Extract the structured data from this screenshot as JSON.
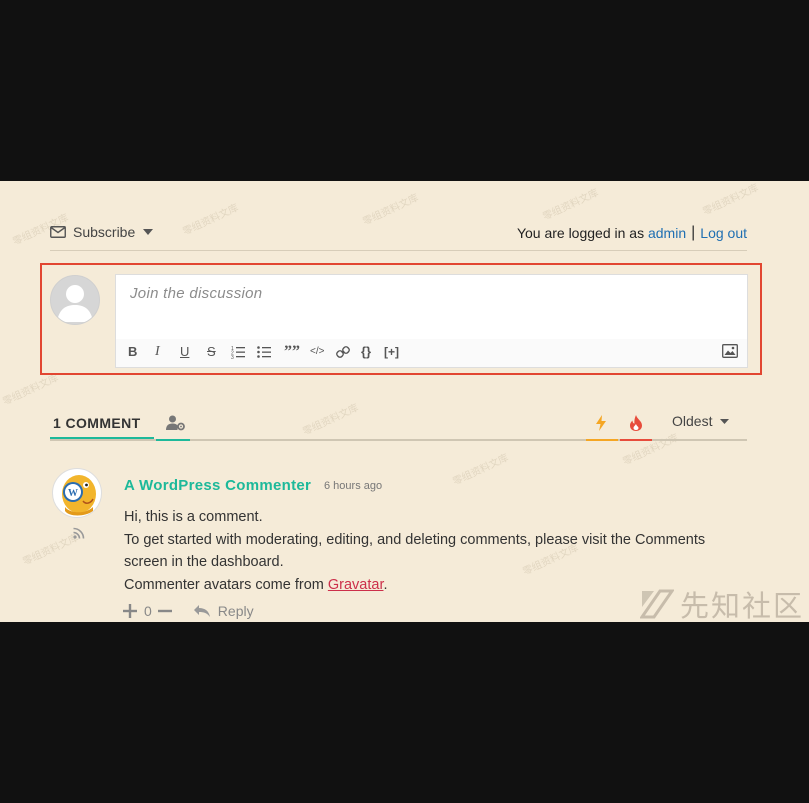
{
  "header": {
    "subscribe_label": "Subscribe",
    "logged_in_text": "You are logged in as",
    "username": "admin",
    "separator": "|",
    "logout_label": "Log out"
  },
  "editor": {
    "placeholder": "Join the discussion",
    "toolbar": {
      "bold": "B",
      "italic": "I",
      "underline": "U",
      "strike": "S",
      "quote": "”",
      "code": "</>",
      "sourcecode": "{}",
      "spoiler": "[+]"
    }
  },
  "threads": {
    "count_label": "1 COMMENT",
    "sort_selected": "Oldest"
  },
  "comment": {
    "author": "A WordPress Commenter",
    "time": "6 hours ago",
    "line1": "Hi, this is a comment.",
    "line2": "To get started with moderating, editing, and deleting comments, please visit the Comments screen in the dashboard.",
    "line3_prefix": "Commenter avatars come from ",
    "line3_link": "Gravatar",
    "line3_suffix": ".",
    "vote_count": "0",
    "reply_label": "Reply"
  },
  "watermark": {
    "site": "先知社区",
    "tile": "零组资料文库"
  },
  "colors": {
    "accent": "#1db99a",
    "link": "#1f6fb2",
    "highlight_box": "#e24631",
    "panel_bg": "#f5ebd8",
    "bolt": "#f5a623",
    "fire": "#e74c3c"
  }
}
